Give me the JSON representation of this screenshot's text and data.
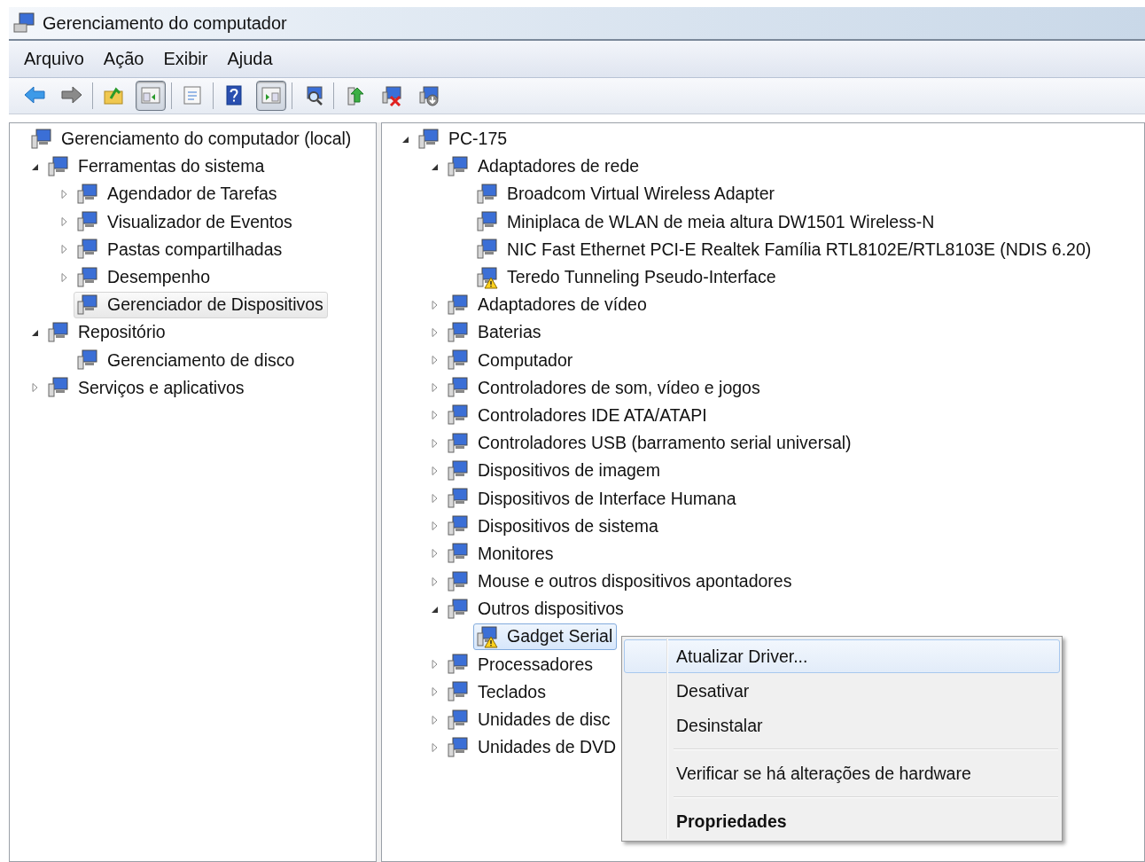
{
  "window": {
    "title": "Gerenciamento do computador"
  },
  "menu_bar": [
    "Arquivo",
    "Ação",
    "Exibir",
    "Ajuda"
  ],
  "toolbar": [
    [
      {
        "pressed": false
      },
      {
        "pressed": false
      }
    ],
    [
      {
        "pressed": false
      },
      {
        "pressed": true
      }
    ],
    [
      {
        "pressed": false
      }
    ],
    [
      {
        "pressed": false
      },
      {
        "pressed": true
      }
    ],
    [
      {
        "pressed": false
      }
    ],
    [
      {
        "pressed": false
      },
      {
        "pressed": false
      },
      {
        "pressed": false
      }
    ]
  ],
  "left_tree": [
    {
      "label": "Gerenciamento do computador (local)",
      "selected": false,
      "children": [
        {
          "label": "Ferramentas do sistema",
          "expanded": true,
          "selected": false,
          "children": [
            {
              "label": "Agendador de Tarefas",
              "expanded": false,
              "selected": false
            },
            {
              "label": "Visualizador de Eventos",
              "expanded": false,
              "selected": false
            },
            {
              "label": "Pastas compartilhadas",
              "expanded": false,
              "selected": false
            },
            {
              "label": "Desempenho",
              "expanded": false,
              "selected": false
            },
            {
              "label": "Gerenciador de Dispositivos",
              "selected": true
            }
          ]
        },
        {
          "label": "Repositório",
          "expanded": true,
          "selected": false,
          "children": [
            {
              "label": "Gerenciamento de disco",
              "selected": false
            }
          ]
        },
        {
          "label": "Serviços e aplicativos",
          "expanded": false,
          "selected": false
        }
      ]
    }
  ],
  "right_tree": [
    {
      "label": "PC-175",
      "expanded": true,
      "selected": false,
      "children": [
        {
          "label": "Adaptadores de rede",
          "expanded": true,
          "selected": false,
          "children": [
            {
              "label": "Broadcom Virtual Wireless Adapter",
              "selected": false
            },
            {
              "label": "Miniplaca de WLAN de meia altura DW1501 Wireless-N",
              "selected": false
            },
            {
              "label": "NIC Fast Ethernet PCI-E Realtek Família RTL8102E/RTL8103E (NDIS 6.20)",
              "selected": false
            },
            {
              "label": "Teredo Tunneling Pseudo-Interface",
              "selected": false,
              "warning": true
            }
          ]
        },
        {
          "label": "Adaptadores de vídeo",
          "expanded": false,
          "selected": false
        },
        {
          "label": "Baterias",
          "expanded": false,
          "selected": false
        },
        {
          "label": "Computador",
          "expanded": false,
          "selected": false
        },
        {
          "label": "Controladores de som, vídeo e jogos",
          "expanded": false,
          "selected": false
        },
        {
          "label": "Controladores IDE ATA/ATAPI",
          "expanded": false,
          "selected": false
        },
        {
          "label": "Controladores USB (barramento serial universal)",
          "expanded": false,
          "selected": false
        },
        {
          "label": "Dispositivos de imagem",
          "expanded": false,
          "selected": false
        },
        {
          "label": "Dispositivos de Interface Humana",
          "expanded": false,
          "selected": false
        },
        {
          "label": "Dispositivos de sistema",
          "expanded": false,
          "selected": false
        },
        {
          "label": "Monitores",
          "expanded": false,
          "selected": false
        },
        {
          "label": "Mouse e outros dispositivos apontadores",
          "expanded": false,
          "selected": false
        },
        {
          "label": "Outros dispositivos",
          "expanded": true,
          "selected": false,
          "children": [
            {
              "label": "Gadget Serial",
              "selected": true,
              "warning": true
            }
          ]
        },
        {
          "label": "Processadores",
          "expanded": false,
          "selected": false
        },
        {
          "label": "Teclados",
          "expanded": false,
          "selected": false
        },
        {
          "label": "Unidades de disc",
          "expanded": false,
          "selected": false
        },
        {
          "label": "Unidades de DVD",
          "expanded": false,
          "selected": false
        }
      ]
    }
  ],
  "context_menu": [
    [
      {
        "label": "Atualizar Driver...",
        "selected": true,
        "default": false
      },
      {
        "label": "Desativar",
        "selected": false,
        "default": false
      },
      {
        "label": "Desinstalar",
        "selected": false,
        "default": false
      }
    ],
    [
      {
        "label": "Verificar se há alterações de hardware",
        "selected": false,
        "default": false
      }
    ],
    [
      {
        "label": "Propriedades",
        "selected": false,
        "default": true
      }
    ]
  ]
}
